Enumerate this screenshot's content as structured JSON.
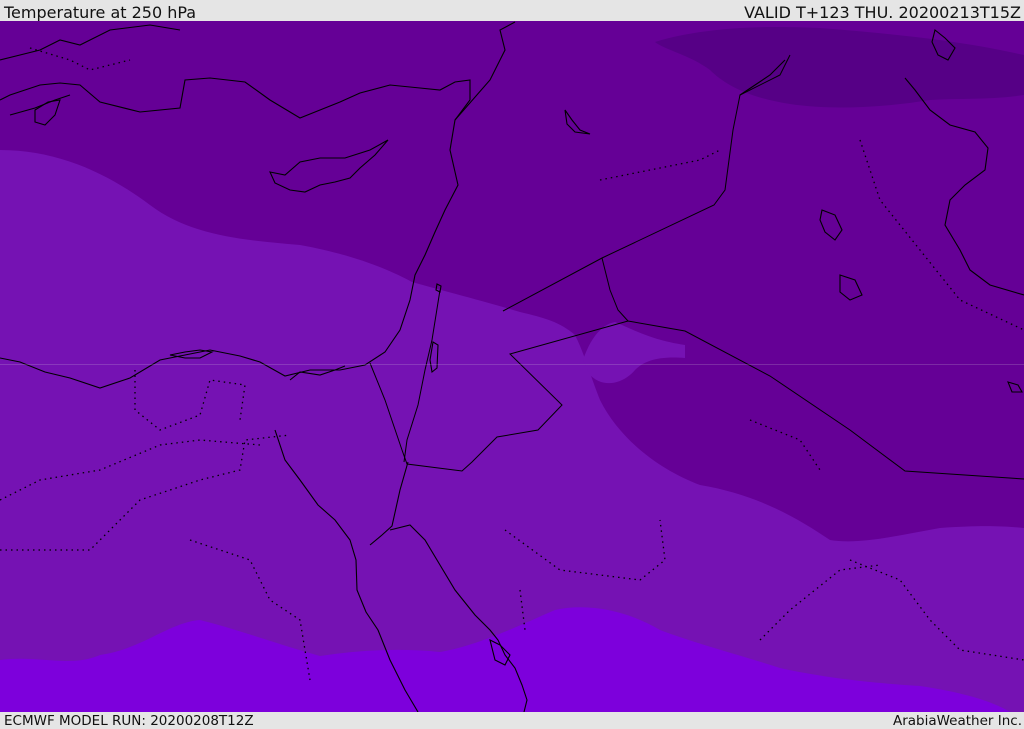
{
  "header": {
    "title": "Temperature at 250 hPa",
    "valid": "VALID T+123 THU. 20200213T15Z"
  },
  "footer": {
    "model_run": "ECMWF MODEL RUN: 20200208T12Z",
    "credit": "ArabiaWeather Inc."
  },
  "colors": {
    "band_coldest": "#560086",
    "band_cold": "#650096",
    "band_mid": "#7512b3",
    "band_warm": "#7d00dc",
    "coastline": "#000000",
    "frame": "#e5e5e5"
  }
}
